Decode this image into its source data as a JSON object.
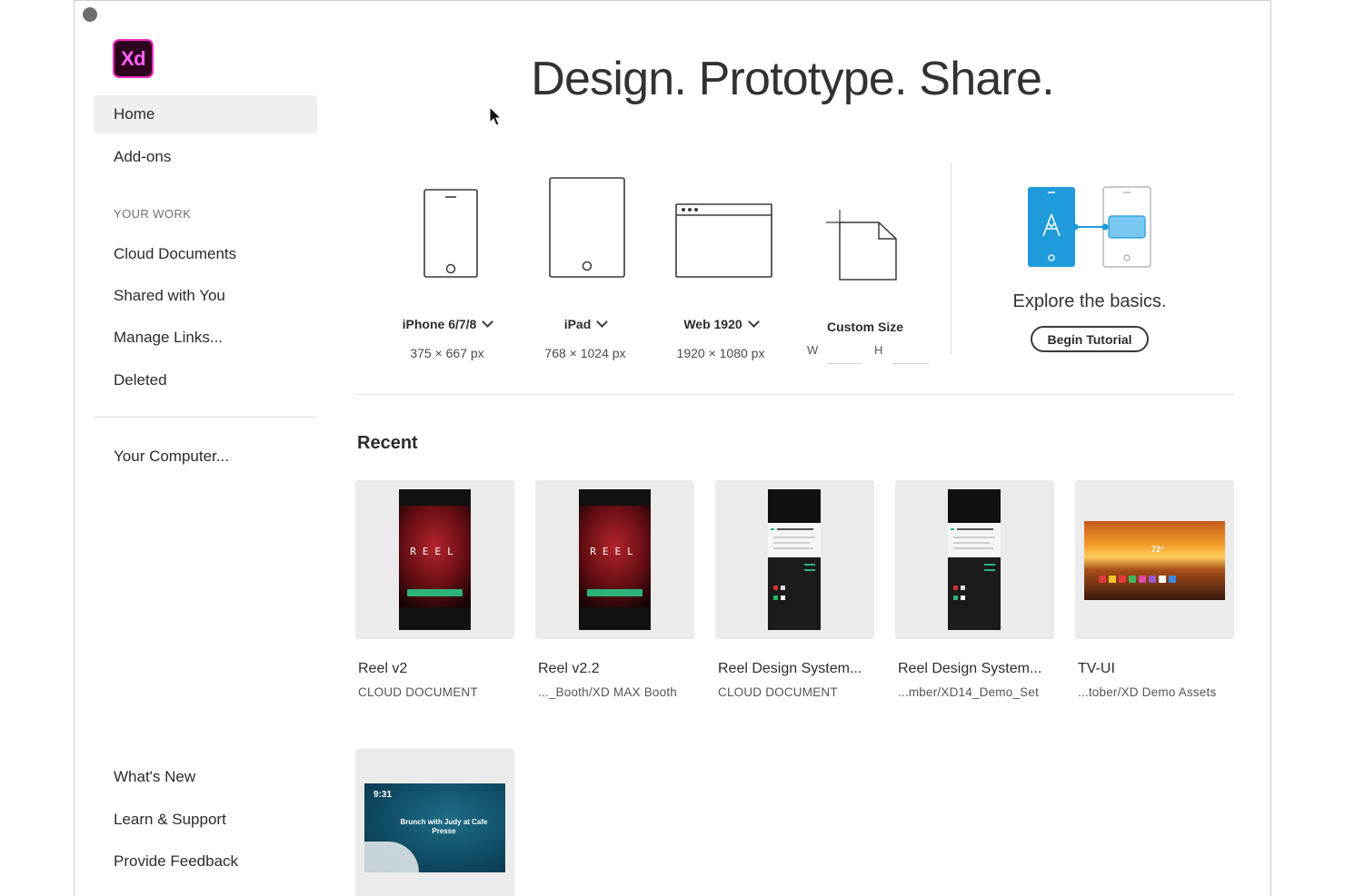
{
  "app": {
    "logo_text": "Xd",
    "hero_title": "Design. Prototype. Share."
  },
  "sidebar": {
    "primary": [
      {
        "label": "Home",
        "active": true
      },
      {
        "label": "Add-ons",
        "active": false
      }
    ],
    "section_heading": "YOUR WORK",
    "work_items": [
      "Cloud Documents",
      "Shared with You",
      "Manage Links...",
      "Deleted"
    ],
    "computer": "Your Computer...",
    "footer_items": [
      "What's New",
      "Learn & Support",
      "Provide Feedback"
    ]
  },
  "presets": [
    {
      "name": "iPhone 6/7/8",
      "size": "375 × 667 px",
      "icon": "phone-icon"
    },
    {
      "name": "iPad",
      "size": "768 × 1024 px",
      "icon": "tablet-icon"
    },
    {
      "name": "Web 1920",
      "size": "1920 × 1080 px",
      "icon": "browser-window-icon"
    },
    {
      "name": "Custom Size",
      "w_label": "W",
      "h_label": "H",
      "w_value": "",
      "h_value": "",
      "icon": "custom-page-icon"
    }
  ],
  "tutorial": {
    "text": "Explore the basics.",
    "button": "Begin Tutorial",
    "accent": "#1f9bdc"
  },
  "recent": {
    "heading": "Recent",
    "items": [
      {
        "title": "Reel v2",
        "subtitle": "CLOUD DOCUMENT",
        "thumb_text": "REEL"
      },
      {
        "title": "Reel v2.2",
        "subtitle": "..._Booth/XD MAX Booth",
        "thumb_text": "REEL"
      },
      {
        "title": "Reel Design System...",
        "subtitle": "CLOUD DOCUMENT"
      },
      {
        "title": "Reel Design System...",
        "subtitle": "...mber/XD14_Demo_Set"
      },
      {
        "title": "TV-UI",
        "subtitle": "...tober/XD Demo Assets",
        "thumb_text": "72°"
      },
      {
        "title": "",
        "subtitle": "",
        "thumb_time": "9:31",
        "thumb_event": "Brunch with Judy at Cafe Presse"
      }
    ]
  },
  "colors": {
    "xd_logo_bg": "#2d001e",
    "xd_logo_fg": "#ff61f6",
    "active_nav_bg": "#efefef",
    "accent_blue": "#1f9bdc",
    "reel_button_green": "#2bb37a"
  }
}
